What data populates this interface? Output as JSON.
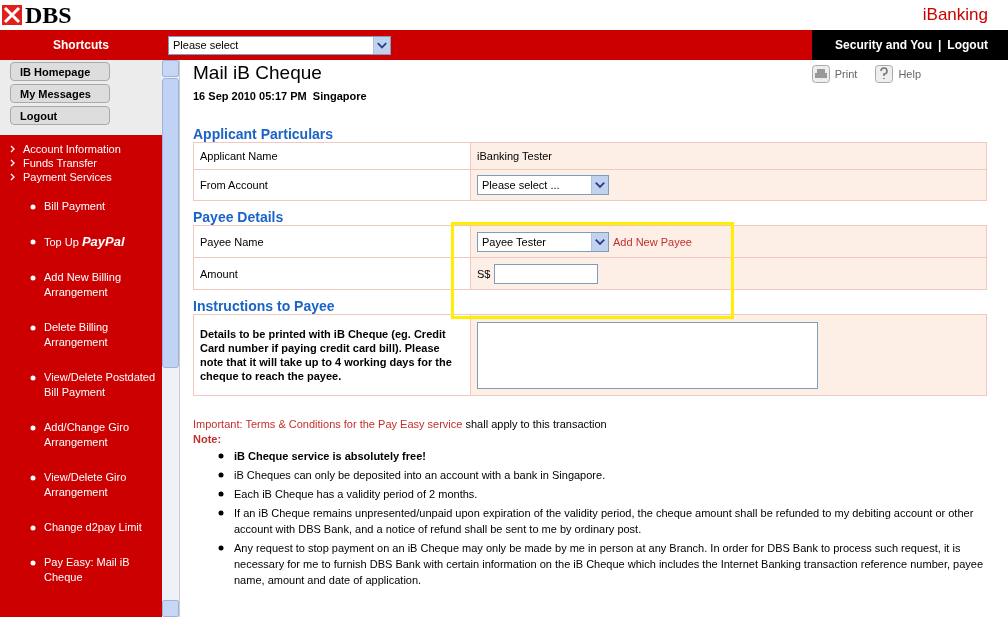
{
  "header": {
    "logo": "DBS",
    "product": "iBanking"
  },
  "topbar": {
    "shortcuts_label": "Shortcuts",
    "shortcut_select": "Please select",
    "links": [
      "Security and You",
      "Logout"
    ],
    "separator": "|"
  },
  "sidebar": {
    "buttons": [
      "IB Homepage",
      "My Messages",
      "Logout"
    ],
    "sections": [
      "Account Information",
      "Funds Transfer",
      "Payment Services"
    ],
    "items": [
      {
        "text": "Bill Payment"
      },
      {
        "text": "Top Up **PayPal**"
      },
      {
        "text": "Add New Billing Arrangement"
      },
      {
        "text": "Delete Billing Arrangement"
      },
      {
        "text": "View/Delete Postdated Bill Payment"
      },
      {
        "text": "Add/Change Giro Arrangement"
      },
      {
        "text": "View/Delete Giro Arrangement"
      },
      {
        "text": "Change d2pay Limit"
      },
      {
        "text": "Pay Easy: Mail iB Cheque"
      }
    ]
  },
  "page": {
    "title": "Mail iB Cheque",
    "datetime": "16 Sep 2010 05:17 PM  Singapore",
    "tools": [
      "Print",
      "Help"
    ]
  },
  "sections": [
    {
      "heading": "Applicant Particulars",
      "rows": [
        {
          "label": "Applicant Name",
          "kind": "text",
          "value": "iBanking Tester"
        },
        {
          "label": "From Account",
          "kind": "select",
          "value": "Please select ..."
        }
      ]
    },
    {
      "heading": "Payee Details",
      "highlighted": true,
      "rows": [
        {
          "label": "Payee Name",
          "kind": "select",
          "value": "Payee Tester",
          "link": "Add New Payee"
        },
        {
          "label": "Amount",
          "kind": "input",
          "prefix": "S$"
        }
      ]
    },
    {
      "heading": "Instructions to Payee",
      "rows": [
        {
          "label": "Details to be printed with iB Cheque (eg. Credit Card number if paying credit card bill). Please note that it will take up to 4 working days for the cheque to reach the payee.",
          "kind": "textarea"
        }
      ]
    }
  ],
  "terms": {
    "important": "Important: Terms & Conditions for the Pay Easy service",
    "rest": "shall apply to this transaction",
    "note": "Note:",
    "bullets": [
      {
        "text": "iB Cheque service is absolutely free!",
        "bold": true
      },
      {
        "text": "iB Cheques can only be deposited into an account with a bank in Singapore.",
        "bold": false
      },
      {
        "text": "Each iB Cheque has a validity period of 2 months.",
        "bold": false
      },
      {
        "text": "If an iB Cheque remains unpresented/unpaid upon expiration of the validity period, the cheque amount shall be refunded to my debiting account or other account with DBS Bank, and a notice of refund shall be sent to me by ordinary post.",
        "bold": false
      },
      {
        "text": "Any request to stop payment on an iB Cheque may only be made by me in person at any Branch. In order for DBS Bank to process such request, it is necessary for me to furnish DBS Bank with certain information on the iB Cheque which includes the Internet Banking transaction reference number, payee name, amount and date of application.",
        "bold": false
      }
    ]
  }
}
